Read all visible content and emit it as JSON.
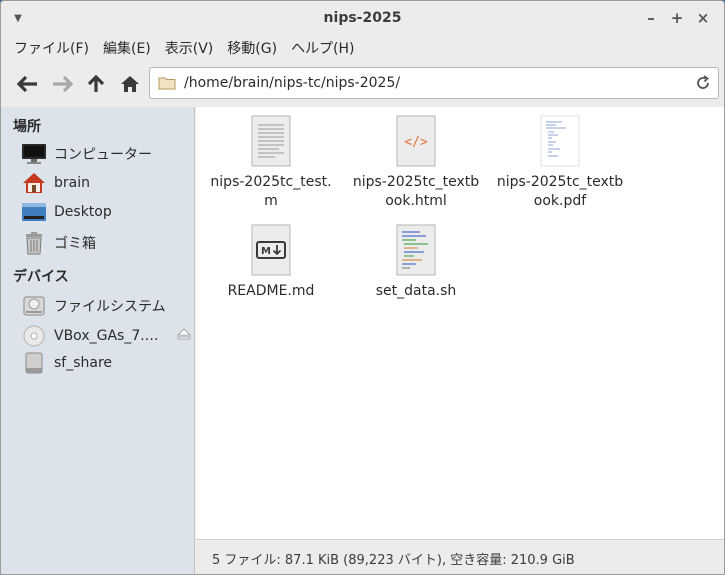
{
  "window": {
    "title": "nips-2025"
  },
  "menubar": {
    "items": [
      "ファイル(F)",
      "編集(E)",
      "表示(V)",
      "移動(G)",
      "ヘルプ(H)"
    ]
  },
  "toolbar": {
    "back": "back-arrow-icon",
    "forward": "forward-arrow-icon",
    "up": "up-arrow-icon",
    "home": "home-icon",
    "location": "/home/brain/nips-tc/nips-2025/"
  },
  "sidebar": {
    "places_header": "場所",
    "places": [
      {
        "label": "コンピューター",
        "icon": "computer-icon"
      },
      {
        "label": "brain",
        "icon": "home-folder-icon"
      },
      {
        "label": "Desktop",
        "icon": "desktop-icon"
      },
      {
        "label": "ゴミ箱",
        "icon": "trash-icon"
      }
    ],
    "devices_header": "デバイス",
    "devices": [
      {
        "label": "ファイルシステム",
        "icon": "drive-icon"
      },
      {
        "label": "VBox_GAs_7.…",
        "icon": "disc-icon"
      },
      {
        "label": "sf_share",
        "icon": "drive-icon"
      }
    ]
  },
  "files": [
    {
      "name": "nips-2025tc_test.m",
      "icon": "text-file-icon"
    },
    {
      "name": "nips-2025tc_textbook.html",
      "icon": "html-file-icon"
    },
    {
      "name": "nips-2025tc_textbook.pdf",
      "icon": "pdf-file-icon"
    },
    {
      "name": "README.md",
      "icon": "markdown-file-icon"
    },
    {
      "name": "set_data.sh",
      "icon": "script-file-icon"
    }
  ],
  "status": "5 ファイル: 87.1 KiB (89,223 バイト), 空き容量: 210.9 GiB",
  "colors": {
    "sidebar_bg": "#dde3ea",
    "accent_orange": "#e8743b",
    "window_bg": "#edeceb"
  }
}
